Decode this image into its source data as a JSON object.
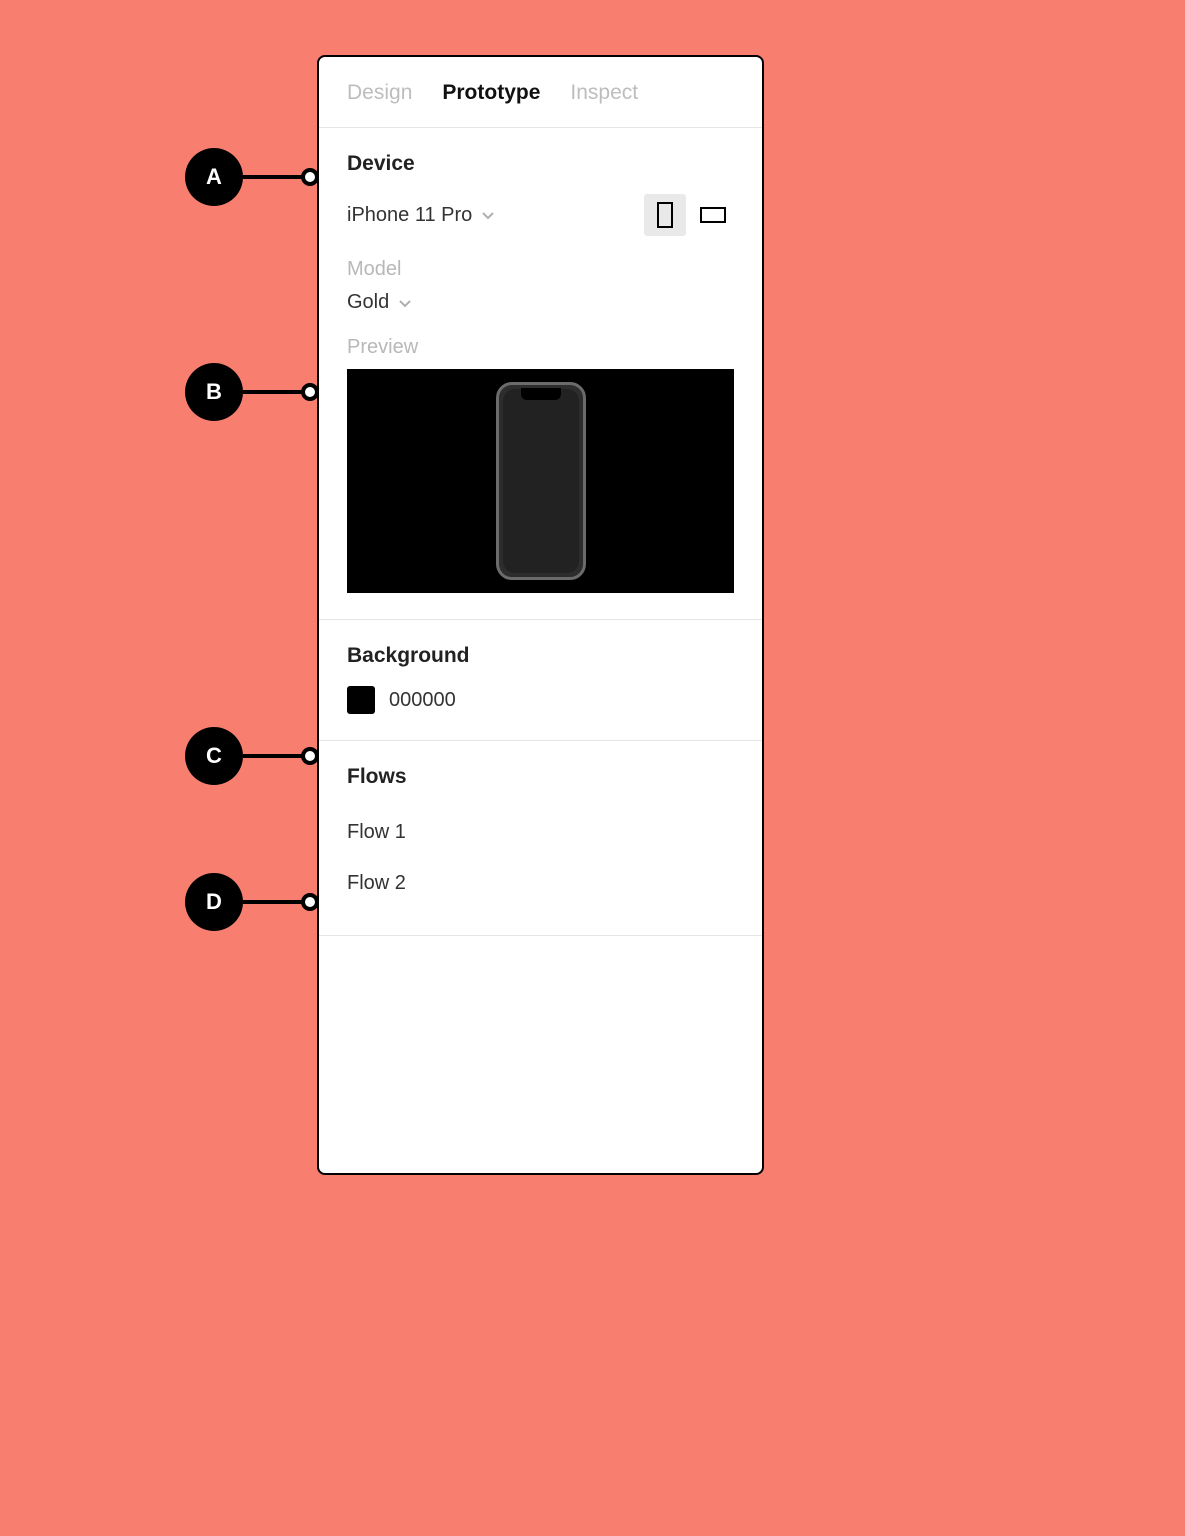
{
  "tabs": {
    "design": "Design",
    "prototype": "Prototype",
    "inspect": "Inspect",
    "active": "prototype"
  },
  "device_section": {
    "title": "Device",
    "device_name": "iPhone 11 Pro",
    "model_label": "Model",
    "model_value": "Gold",
    "preview_label": "Preview",
    "orientation": "portrait"
  },
  "background_section": {
    "title": "Background",
    "color_hex": "000000"
  },
  "flows_section": {
    "title": "Flows",
    "items": [
      "Flow 1",
      "Flow 2"
    ]
  },
  "callouts": {
    "a": "A",
    "b": "B",
    "c": "C",
    "d": "D"
  }
}
